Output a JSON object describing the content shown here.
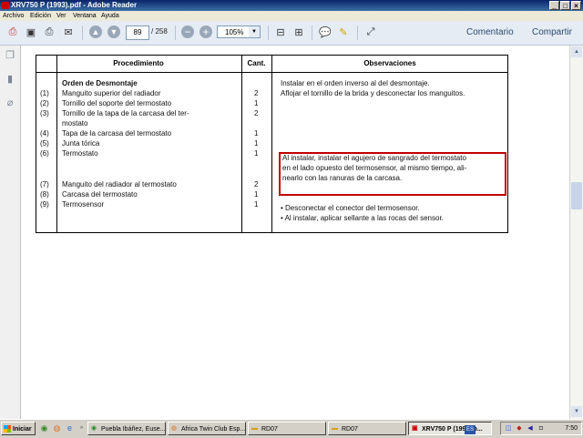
{
  "window": {
    "title": "XRV750 P (1993).pdf - Adobe Reader"
  },
  "menu": {
    "items": [
      "Archivo",
      "Edición",
      "Ver",
      "Ventana",
      "Ayuda"
    ]
  },
  "toolbar": {
    "page_current": "89",
    "page_total": "/ 258",
    "zoom": "105%",
    "comment_label": "Comentario",
    "share_label": "Compartir"
  },
  "document": {
    "headers": {
      "procedure": "Procedimiento",
      "qty": "Cant.",
      "observations": "Observaciones"
    },
    "section_title": "Orden de Desmontaje",
    "rows": [
      {
        "num": "(1)",
        "name": "Manguito superior del radiador",
        "qty": "2"
      },
      {
        "num": "(2)",
        "name": "Tornillo del soporte del termostato",
        "qty": "1"
      },
      {
        "num": "(3)",
        "name": "Tornillo de la tapa de la carcasa del ter-",
        "name2": "mostato",
        "qty": "2"
      },
      {
        "num": "(4)",
        "name": "Tapa de la carcasa del termostato",
        "qty": "1"
      },
      {
        "num": "(5)",
        "name": "Junta tórica",
        "qty": "1"
      },
      {
        "num": "(6)",
        "name": "Termostato",
        "qty": "1"
      },
      {
        "num": "(7)",
        "name": "Manguito del radiador al termostato",
        "qty": "2"
      },
      {
        "num": "(8)",
        "name": "Carcasa del termostato",
        "qty": "1"
      },
      {
        "num": "(9)",
        "name": "Termosensor",
        "qty": "1"
      }
    ],
    "observations": {
      "line1": "Instalar en el orden inverso al del desmontaje.",
      "line2": "Aflojar el tornillo de la brida y desconectar los manguitos.",
      "box1": "Al instalar, instalar el agujero de sangrado del termostato",
      "box2": "en el lado opuesto del termosensor, al mismo tiempo, ali-",
      "box3": "nearlo con las ranuras de la carcasa.",
      "bullet1": "• Desconectar el conector del termosensor.",
      "bullet2": "• Al instalar, aplicar sellante a las rocas del sensor."
    }
  },
  "taskbar": {
    "start_label": "Iniciar",
    "tasks": [
      "Puebla Ibáñez, Euse...",
      "Africa Twin Club Esp...",
      "RD07",
      "RD07",
      "XRV750 P (1993).p..."
    ],
    "lang": "ES",
    "clock": "7:50"
  }
}
